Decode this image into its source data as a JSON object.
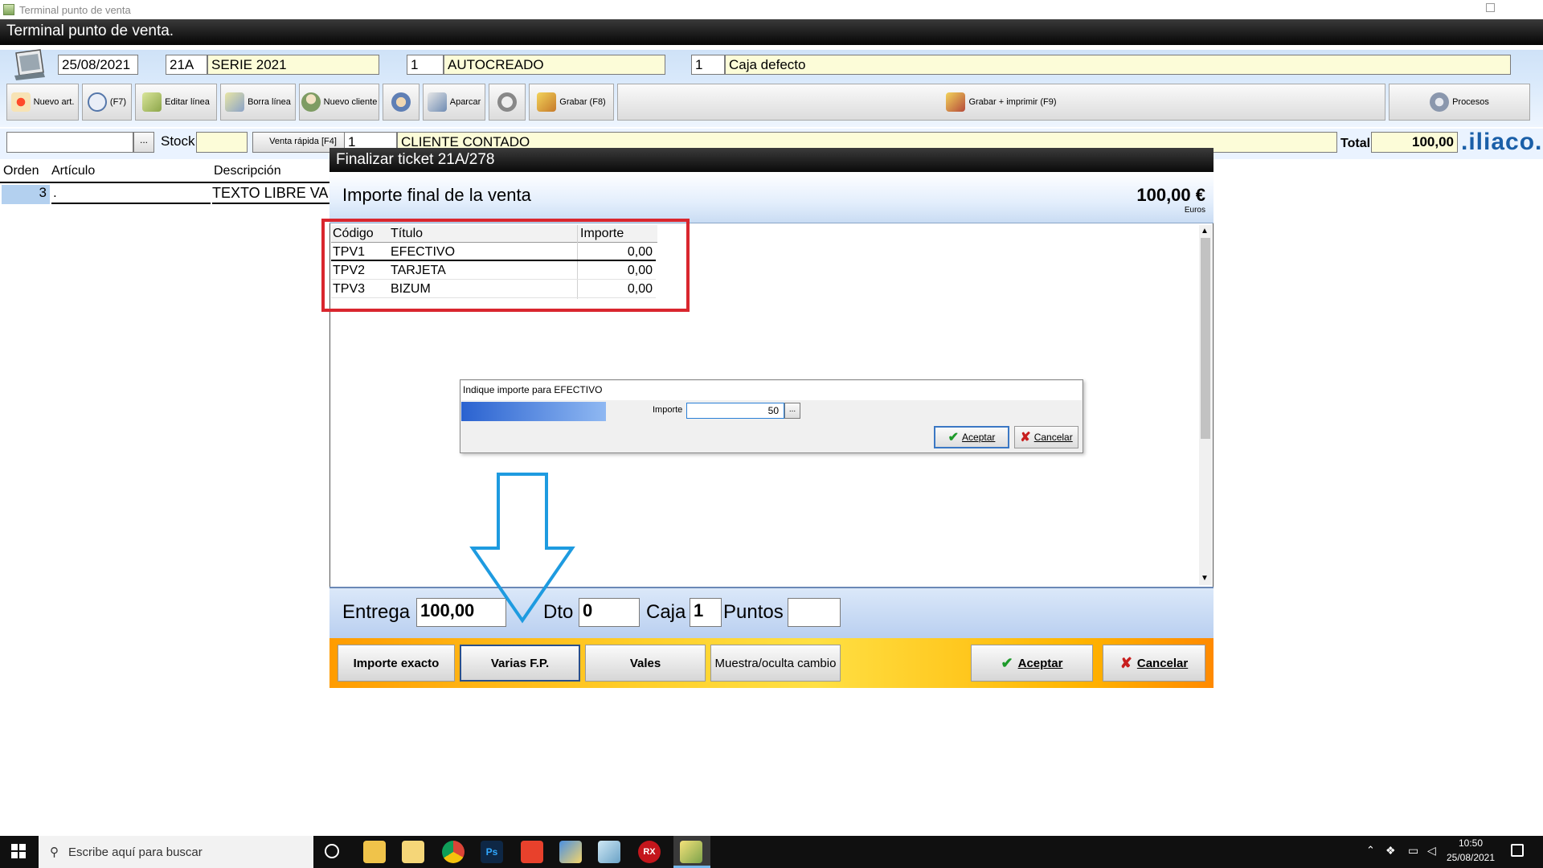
{
  "window": {
    "title": "Terminal punto de venta"
  },
  "app": {
    "header": "Terminal punto de venta.",
    "date": "25/08/2021",
    "serie_code": "21A",
    "serie_name": "SERIE 2021",
    "user_code": "1",
    "user_name": "AUTOCREADO",
    "caja_code": "1",
    "caja_name": "Caja defecto"
  },
  "toolbar": {
    "nuevo_art": "Nuevo art.",
    "f7": "(F7)",
    "editar_linea": "Editar línea",
    "borra_linea": "Borra línea",
    "nuevo_cliente": "Nuevo cliente",
    "aparcar": "Aparcar",
    "grabar": "Grabar (F8)",
    "grabar_imprimir": "Grabar + imprimir (F9)",
    "procesos": "Procesos"
  },
  "search_row": {
    "search_value": "",
    "browse": "...",
    "stock_label": "Stock",
    "stock_value": "",
    "venta_rapida": "Venta rápida [F4]",
    "cliente_code": "1",
    "cliente_name": "CLIENTE CONTADO",
    "total_label": "Total",
    "total_value": "100,00",
    "brand": ".iliaco."
  },
  "grid": {
    "headers": [
      "Orden",
      "Artículo",
      "Descripción"
    ],
    "row": {
      "orden": "3",
      "articulo": ".",
      "descripcion": "TEXTO LIBRE VA"
    }
  },
  "modal": {
    "title": "Finalizar ticket 21A/278",
    "subtitle": "Importe final de la venta",
    "amount": "100,00 €",
    "currency": "Euros",
    "table": {
      "headers": [
        "Código",
        "Título",
        "Importe"
      ],
      "rows": [
        {
          "codigo": "TPV1",
          "titulo": "EFECTIVO",
          "importe": "0,00"
        },
        {
          "codigo": "TPV2",
          "titulo": "TARJETA",
          "importe": "0,00"
        },
        {
          "codigo": "TPV3",
          "titulo": "BIZUM",
          "importe": "0,00"
        }
      ]
    },
    "entrega_label": "Entrega",
    "entrega_value": "100,00",
    "dto_label": "Dto",
    "dto_value": "0",
    "caja_label": "Caja",
    "caja_value": "1",
    "puntos_label": "Puntos",
    "puntos_value": "",
    "buttons": {
      "importe_exacto": "Importe exacto",
      "varias_fp": "Varias F.P.",
      "vales": "Vales",
      "muestra_cambio": "Muestra/oculta cambio",
      "aceptar": "Aceptar",
      "cancelar": "Cancelar"
    }
  },
  "subdialog": {
    "title": "Indique importe para EFECTIVO",
    "importe_label": "Importe",
    "importe_value": "50",
    "browse": "...",
    "aceptar": "Aceptar",
    "cancelar": "Cancelar"
  },
  "taskbar": {
    "search_placeholder": "Escribe aquí para buscar",
    "time": "10:50",
    "date": "25/08/2021"
  },
  "colors": {
    "highlight_box": "#d9262e",
    "arrow": "#1e9be0",
    "action_bar": "#ffc21a",
    "yellow_field": "#fcfcd8"
  }
}
